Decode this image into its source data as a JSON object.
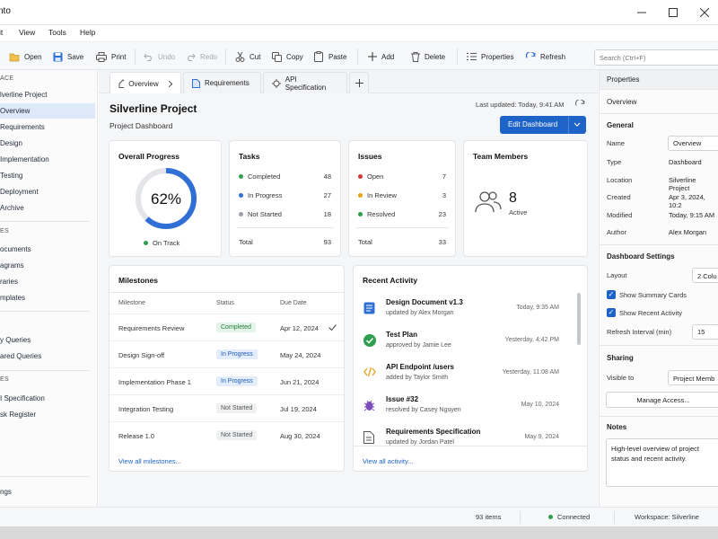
{
  "window": {
    "title": "nto"
  },
  "menu": [
    "it",
    "View",
    "Tools",
    "Help"
  ],
  "toolbar": {
    "open": "Open",
    "save": "Save",
    "print": "Print",
    "undo": "Undo",
    "redo": "Redo",
    "cut": "Cut",
    "copy": "Copy",
    "paste": "Paste",
    "add": "Add",
    "delete": "Delete",
    "properties": "Properties",
    "refresh": "Refresh",
    "search_placeholder": "Search (Ctrl+F)"
  },
  "sidebar": {
    "section1": "ACE",
    "items1": [
      "lverline Project",
      "Overview",
      "Requirements",
      "Design",
      "Implementation",
      "Testing",
      "Deployment",
      "Archive"
    ],
    "section2": "ES",
    "items2": [
      "ocuments",
      "agrams",
      "raries",
      "mplates"
    ],
    "items3": [
      "y Queries",
      "ared Queries"
    ],
    "section3": "ES",
    "items4": [
      "I Specification",
      "sk Register"
    ],
    "bottom": "ngs"
  },
  "tabs": [
    "Overview",
    "Requirements",
    "API Specification"
  ],
  "header": {
    "title": "Silverline Project",
    "subtitle": "Project Dashboard",
    "last_updated": "Last updated: Today, 9:41 AM",
    "edit_button": "Edit Dashboard"
  },
  "progress": {
    "title": "Overall Progress",
    "percent_label": "62%",
    "value": 62,
    "status": "On Track"
  },
  "tasks": {
    "title": "Tasks",
    "rows": [
      {
        "label": "Completed",
        "value": "48",
        "color": "#2e9e4f"
      },
      {
        "label": "In Progress",
        "value": "27",
        "color": "#2f6fd6"
      },
      {
        "label": "Not Started",
        "value": "18",
        "color": "#9aa0a6"
      }
    ],
    "total_label": "Total",
    "total": "93"
  },
  "issues": {
    "title": "Issues",
    "rows": [
      {
        "label": "Open",
        "value": "7",
        "color": "#d93636"
      },
      {
        "label": "In Review",
        "value": "3",
        "color": "#e8a21a"
      },
      {
        "label": "Resolved",
        "value": "23",
        "color": "#2e9e4f"
      }
    ],
    "total_label": "Total",
    "total": "33"
  },
  "team": {
    "title": "Team Members",
    "count": "8",
    "label": "Active"
  },
  "milestones": {
    "title": "Milestones",
    "headers": [
      "Milestone",
      "Status",
      "Due Date"
    ],
    "rows": [
      {
        "name": "Requirements Review",
        "status": "Completed",
        "date": "Apr 12, 2024"
      },
      {
        "name": "Design Sign-off",
        "status": "In Progress",
        "date": "May 24, 2024"
      },
      {
        "name": "Implementation Phase 1",
        "status": "In Progress",
        "date": "Jun 21, 2024"
      },
      {
        "name": "Integration Testing",
        "status": "Not Started",
        "date": "Jul 19, 2024"
      },
      {
        "name": "Release 1.0",
        "status": "Not Started",
        "date": "Aug 30, 2024"
      }
    ],
    "view_all": "View all milestones..."
  },
  "activity": {
    "title": "Recent Activity",
    "items": [
      {
        "title": "Design Document v1.3",
        "sub": "updated by Alex Morgan",
        "time": "Today, 9:35 AM"
      },
      {
        "title": "Test Plan",
        "sub": "approved by Jamie Lee",
        "time": "Yesterday, 4:42 PM"
      },
      {
        "title": "API Endpoint /users",
        "sub": "added by Taylor Smith",
        "time": "Yesterday, 11:08 AM"
      },
      {
        "title": "Issue #32",
        "sub": "resolved by Casey Nguyen",
        "time": "May 10, 2024"
      },
      {
        "title": "Requirements Specification",
        "sub": "updated by Jordan Patel",
        "time": "May 9, 2024"
      }
    ],
    "view_all": "View all activity..."
  },
  "properties": {
    "header": "Properties",
    "object": "Overview",
    "general_title": "General",
    "name_label": "Name",
    "name_value": "Overview",
    "type_label": "Type",
    "type_value": "Dashboard",
    "location_label": "Location",
    "location_value": "Silverline Project",
    "created_label": "Created",
    "created_value": "Apr 3, 2024, 10:2",
    "modified_label": "Modified",
    "modified_value": "Today, 9:15 AM",
    "author_label": "Author",
    "author_value": "Alex Morgan",
    "dash_title": "Dashboard Settings",
    "layout_label": "Layout",
    "layout_value": "2 Colu",
    "show_summary": "Show Summary Cards",
    "show_recent": "Show Recent Activity",
    "refresh_label": "Refresh Interval (min)",
    "refresh_value": "15",
    "sharing_title": "Sharing",
    "visible_label": "Visible to",
    "visible_value": "Project Memb",
    "manage_access": "Manage Access...",
    "notes_title": "Notes",
    "notes_text": "High-level overview of project status and recent activity."
  },
  "status": {
    "items": "93 items",
    "connection": "Connected",
    "workspace": "Workspace: Silverline"
  }
}
